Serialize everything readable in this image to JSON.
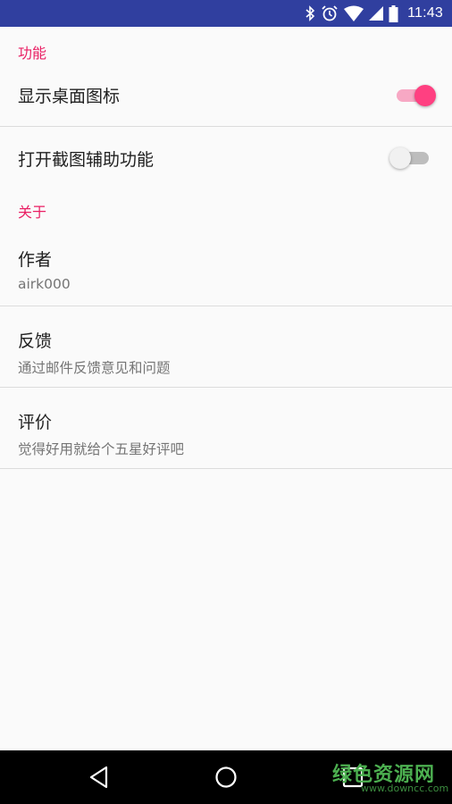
{
  "status_bar": {
    "time": "11:43",
    "icons": [
      "bluetooth-icon",
      "alarm-icon",
      "wifi-icon",
      "cellular-signal-icon",
      "battery-icon"
    ],
    "background_color": "#303f9f"
  },
  "categories": {
    "functions": "功能",
    "about": "关于"
  },
  "preferences": {
    "show_icon": {
      "title": "显示桌面图标",
      "enabled": true
    },
    "screenshot_assist": {
      "title": "打开截图辅助功能",
      "enabled": false
    },
    "author": {
      "title": "作者",
      "summary": "airk000"
    },
    "feedback": {
      "title": "反馈",
      "summary": "通过邮件反馈意见和问题"
    },
    "rate": {
      "title": "评价",
      "summary": "觉得好用就给个五星好评吧"
    }
  },
  "nav_bar": {
    "buttons": [
      "back-icon",
      "home-icon",
      "recents-icon"
    ]
  },
  "watermark": {
    "text": "绿色资源网",
    "url": "www.downcc.com"
  },
  "colors": {
    "accent": "#ff4081",
    "category_text": "#e91e63"
  }
}
